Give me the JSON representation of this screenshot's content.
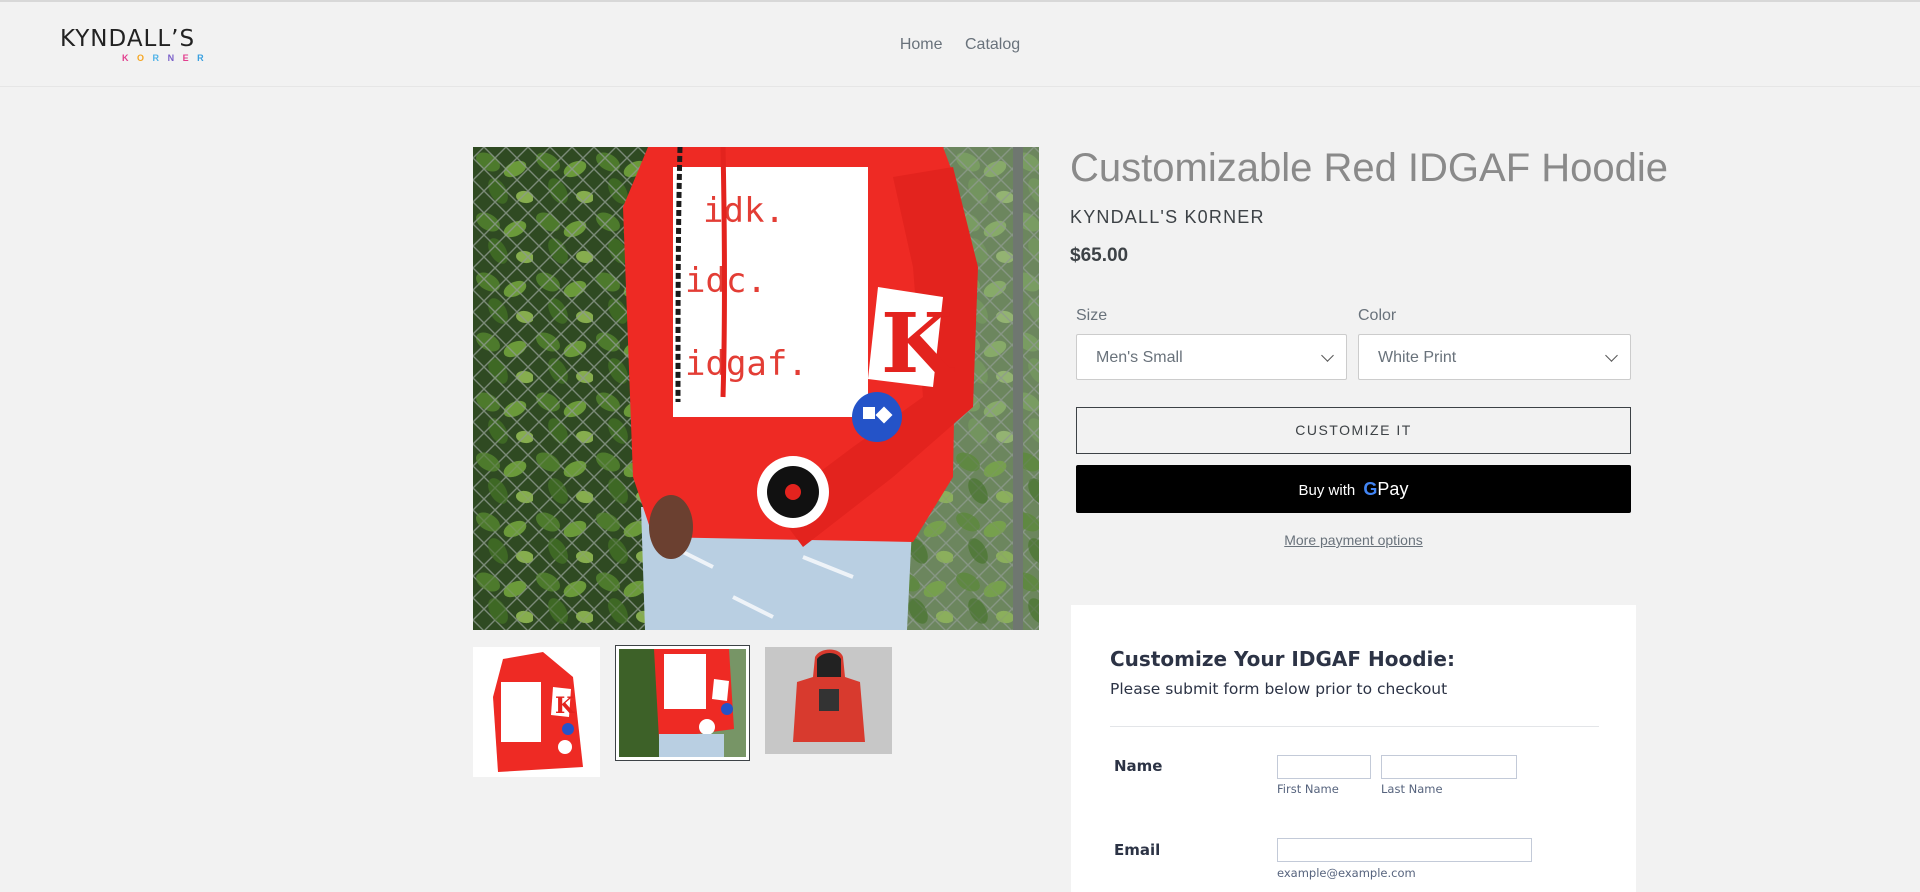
{
  "header": {
    "logo_word": "KYNDALL’S",
    "logo_sub_letters": [
      "K",
      "O",
      "R",
      "N",
      "E",
      "R"
    ],
    "nav": [
      {
        "label": "Home"
      },
      {
        "label": "Catalog"
      }
    ]
  },
  "media": {
    "main_image_alt": "Model wearing red IDGAF hoodie",
    "print_lines": [
      "idk.",
      "idc.",
      "idgaf."
    ],
    "thumbnails": [
      {
        "alt": "Red hoodie side view"
      },
      {
        "alt": "Red hoodie front view",
        "selected": true
      },
      {
        "alt": "Red hoodie back view"
      }
    ]
  },
  "product": {
    "title": "Customizable Red IDGAF Hoodie",
    "vendor": "KYNDALL'S K0RNER",
    "price": "$65.00",
    "options": [
      {
        "label": "Size",
        "value": "Men's Small"
      },
      {
        "label": "Color",
        "value": "White Print"
      }
    ],
    "customize_label": "CUSTOMIZE IT",
    "gpay_prefix": "Buy with",
    "gpay_g": "G",
    "gpay_pay": "Pay",
    "more_payment": "More payment options"
  },
  "form": {
    "title": "Customize Your IDGAF Hoodie:",
    "subtitle": "Please submit form below prior to checkout",
    "name_label": "Name",
    "first_name_help": "First Name",
    "last_name_help": "Last Name",
    "email_label": "Email",
    "email_help": "example@example.com"
  },
  "colors": {
    "background": "#f2f2f2",
    "hoodie_red": "#ee2a24",
    "gpay_button": "#000000",
    "logo_accent": "#e23f8f"
  }
}
